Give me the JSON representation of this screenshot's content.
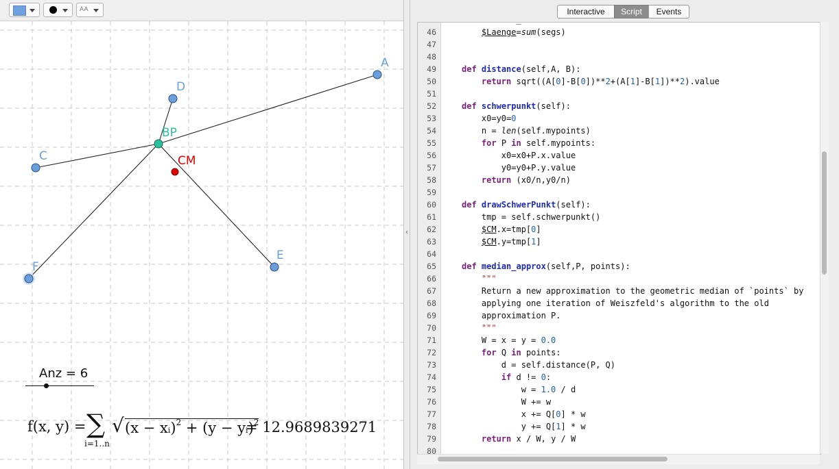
{
  "style_bar": {
    "color_button_color": "#6fa0e0",
    "point_style_color": "#000000",
    "label_style_text": "AA"
  },
  "graphics": {
    "points": [
      {
        "name": "A",
        "color": "#6a9fdc"
      },
      {
        "name": "D",
        "color": "#6a9fdc"
      },
      {
        "name": "BP",
        "color": "#2bbf9a"
      },
      {
        "name": "C",
        "color": "#6a9fdc"
      },
      {
        "name": "CM",
        "color": "#e00000"
      },
      {
        "name": "E",
        "color": "#6a9fdc"
      },
      {
        "name": "F",
        "color": "#6a9fdc"
      }
    ],
    "slider": {
      "label": "Anz = 6",
      "value": 6
    },
    "formula": {
      "lhs": "f(x, y) =",
      "sigma": "∑",
      "index": "i=1..n",
      "sqrt": "√",
      "term_open": "(x − x",
      "term_sub": "i",
      "term_close": ")",
      "sq": "2",
      "plus": " + ",
      "term2_open": "(y − y",
      "term2_sub": "i",
      "term2_close": ")",
      "sq2": "2",
      "result": "= 12.9689839271"
    }
  },
  "script_panel": {
    "tabs": [
      {
        "label": "Interactive",
        "selected": false
      },
      {
        "label": "Script",
        "selected": true
      },
      {
        "label": "Events",
        "selected": false
      }
    ],
    "scroll": {
      "vertical_fraction": 0.42,
      "horizontal_fraction": 0.0
    },
    "lines": [
      {
        "n": "",
        "code": "    s.label_visible=False"
      },
      {
        "n": "46",
        "code": "    $Laenge=sum(segs)"
      },
      {
        "n": "47",
        "code": ""
      },
      {
        "n": "48",
        "code": ""
      },
      {
        "n": "49",
        "code": "def distance(self,A, B):"
      },
      {
        "n": "50",
        "code": "    return sqrt((A[0]-B[0])**2+(A[1]-B[1])**2).value"
      },
      {
        "n": "51",
        "code": ""
      },
      {
        "n": "52",
        "code": "def schwerpunkt(self):"
      },
      {
        "n": "53",
        "code": "    x0=y0=0"
      },
      {
        "n": "54",
        "code": "    n = len(self.mypoints)"
      },
      {
        "n": "55",
        "code": "    for P in self.mypoints:"
      },
      {
        "n": "56",
        "code": "        x0=x0+P.x.value"
      },
      {
        "n": "57",
        "code": "        y0=y0+P.y.value"
      },
      {
        "n": "58",
        "code": "    return (x0/n,y0/n)"
      },
      {
        "n": "59",
        "code": ""
      },
      {
        "n": "60",
        "code": "def drawSchwerPunkt(self):"
      },
      {
        "n": "61",
        "code": "    tmp = self.schwerpunkt()"
      },
      {
        "n": "62",
        "code": "    $CM.x=tmp[0]"
      },
      {
        "n": "63",
        "code": "    $CM.y=tmp[1]"
      },
      {
        "n": "64",
        "code": ""
      },
      {
        "n": "65",
        "code": "def median_approx(self,P, points):"
      },
      {
        "n": "66",
        "code": "    \"\"\""
      },
      {
        "n": "67",
        "code": "    Return a new approximation to the geometric median of `points` by"
      },
      {
        "n": "68",
        "code": "    applying one iteration of Weiszfeld's algorithm to the old"
      },
      {
        "n": "69",
        "code": "    approximation P."
      },
      {
        "n": "70",
        "code": "    \"\"\""
      },
      {
        "n": "71",
        "code": "    W = x = y = 0.0"
      },
      {
        "n": "72",
        "code": "    for Q in points:"
      },
      {
        "n": "73",
        "code": "        d = self.distance(P, Q)"
      },
      {
        "n": "74",
        "code": "        if d != 0:"
      },
      {
        "n": "75",
        "code": "            w = 1.0 / d"
      },
      {
        "n": "76",
        "code": "            W += w"
      },
      {
        "n": "77",
        "code": "            x += Q[0] * w"
      },
      {
        "n": "78",
        "code": "            y += Q[1] * w"
      },
      {
        "n": "79",
        "code": "    return x / W, y / W"
      },
      {
        "n": "80",
        "code": ""
      }
    ]
  }
}
